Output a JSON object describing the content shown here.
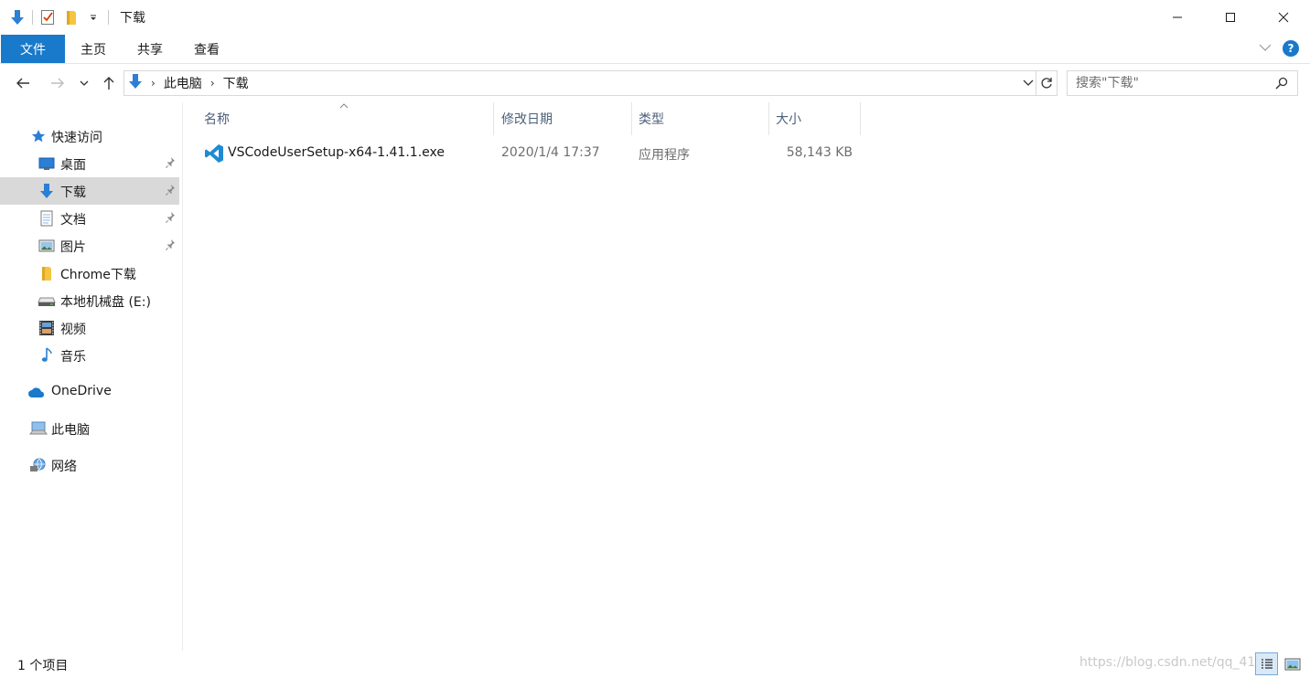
{
  "window": {
    "title": "下载"
  },
  "ribbon": {
    "tabs": [
      "文件",
      "主页",
      "共享",
      "查看"
    ],
    "help_label": "?"
  },
  "address": {
    "segments": [
      "此电脑",
      "下载"
    ]
  },
  "search": {
    "placeholder": "搜索\"下载\""
  },
  "nav": {
    "quick_access": "快速访问",
    "items": [
      {
        "label": "桌面",
        "icon": "desktop-icon",
        "pinned": true
      },
      {
        "label": "下载",
        "icon": "download-arrow-icon",
        "pinned": true,
        "selected": true
      },
      {
        "label": "文档",
        "icon": "document-icon",
        "pinned": true
      },
      {
        "label": "图片",
        "icon": "picture-icon",
        "pinned": true
      },
      {
        "label": "Chrome下载",
        "icon": "folder-icon",
        "pinned": false
      },
      {
        "label": "本地机械盘 (E:)",
        "icon": "drive-icon",
        "pinned": false
      },
      {
        "label": "视频",
        "icon": "video-icon",
        "pinned": false
      },
      {
        "label": "音乐",
        "icon": "music-icon",
        "pinned": false
      }
    ],
    "onedrive": "OneDrive",
    "this_pc": "此电脑",
    "network": "网络"
  },
  "columns": {
    "name": "名称",
    "modified": "修改日期",
    "type": "类型",
    "size": "大小"
  },
  "files": [
    {
      "name": "VSCodeUserSetup-x64-1.41.1.exe",
      "modified": "2020/1/4 17:37",
      "type": "应用程序",
      "size": "58,143 KB",
      "icon": "vscode-icon"
    }
  ],
  "status": {
    "count": "1 个项目",
    "watermark": "https://blog.csdn.net/qq_41"
  },
  "colors": {
    "accent": "#1979ca",
    "selected_bg": "#d9d9d9",
    "header_text": "#4c607a"
  }
}
